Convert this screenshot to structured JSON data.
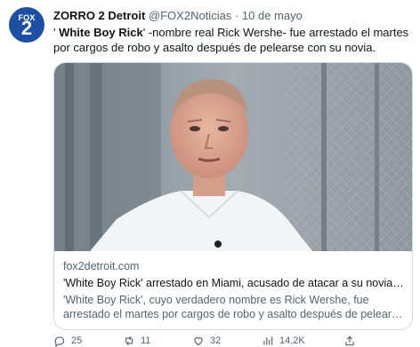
{
  "author": {
    "avatar_brand": "FOX",
    "avatar_number": "2",
    "display_name": "ZORRO 2 Detroit",
    "handle": "@FOX2Noticias",
    "separator": "·",
    "date": "10 de mayo"
  },
  "tweet": {
    "quote_open": "' ",
    "highlight": "White Boy Rick",
    "text_rest": "' -nombre real Rick Wershe- fue arrestado el martes por cargos de robo y asalto después de pelearse con su novia."
  },
  "link_card": {
    "domain": "fox2detroit.com",
    "title": "'White Boy Rick' arrestado en Miami, acusado de atacar a su novia d...",
    "description_line1": "'White Boy Rick', cuyo verdadero nombre es Rick Wershe, fue",
    "description_line2": "arrestado el martes por cargos de robo y asalto después de pelears..."
  },
  "actions": {
    "replies": "25",
    "retweets": "11",
    "likes": "32",
    "views": "14,2K"
  },
  "icons": [
    "reply-icon",
    "retweet-icon",
    "like-icon",
    "views-icon",
    "share-icon"
  ],
  "colors": {
    "brand_blue": "#1d4fa3",
    "muted_text": "#536471",
    "border": "#cfd9de"
  }
}
